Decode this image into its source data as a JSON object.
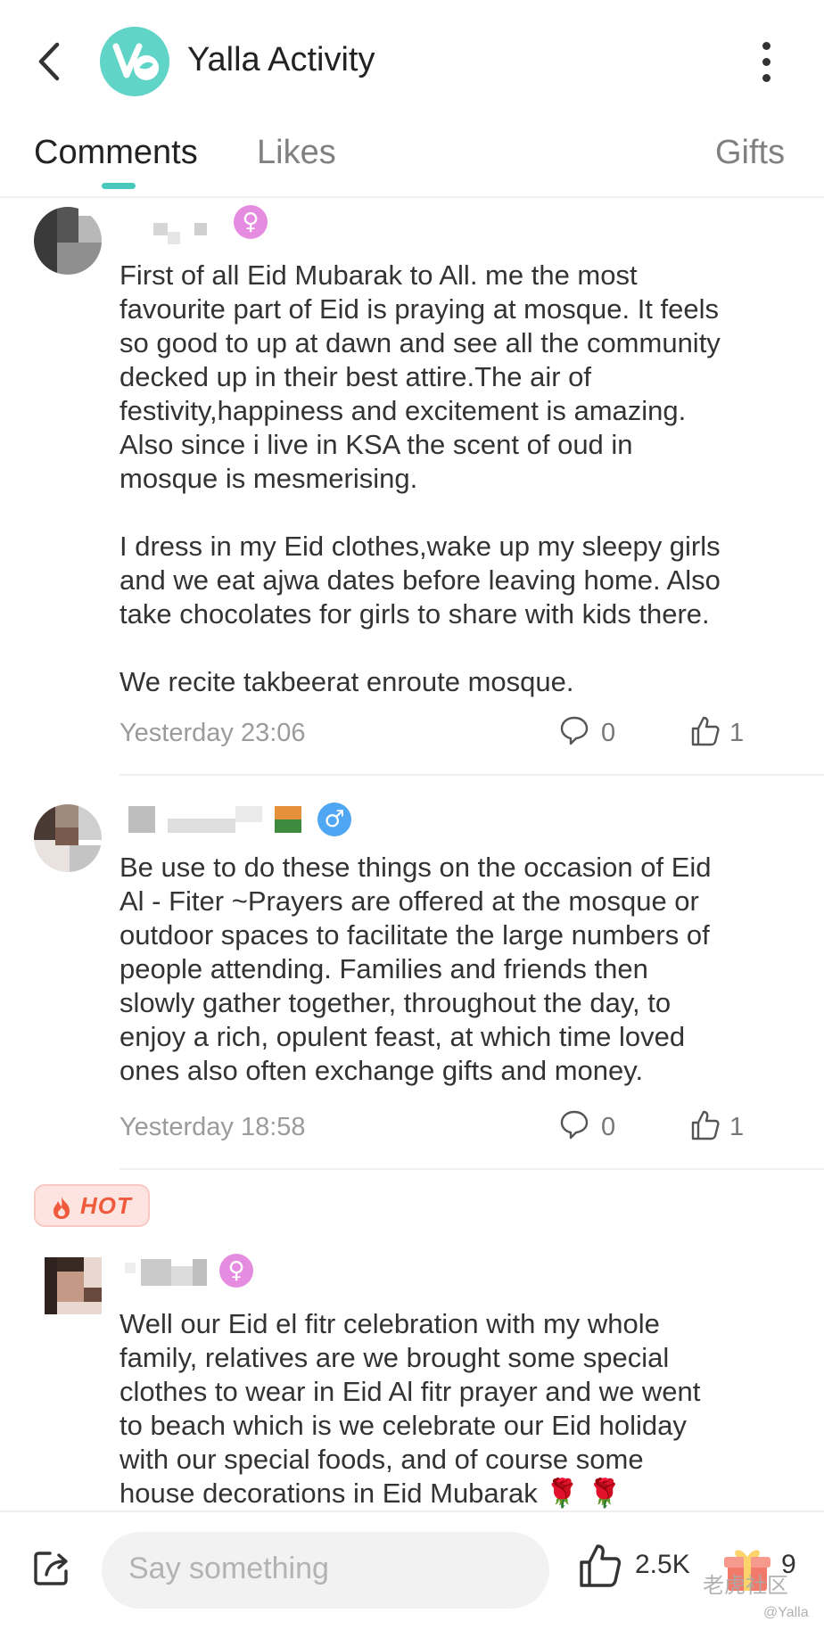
{
  "header": {
    "title": "Yalla Activity",
    "logo_color": "#5fd4c7"
  },
  "tabs": [
    {
      "label": "Comments",
      "active": true
    },
    {
      "label": "Likes",
      "active": false
    },
    {
      "label": "Gifts",
      "active": false
    }
  ],
  "accent_color": "#48c9bc",
  "comments": [
    {
      "gender": "female",
      "gender_icon": "female-symbol-icon",
      "text": "First of all Eid Mubarak to All. me the most\nfavourite part of Eid is praying at mosque. It feels\nso good to up at dawn and see all the community\ndecked up in their best attire.The air of\nfestivity,happiness and excitement is amazing.\nAlso since i live in KSA the scent of oud in\nmosque is mesmerising.\n\nI dress in my Eid clothes,wake up my sleepy girls\nand we eat ajwa dates before leaving home. Also\ntake chocolates for girls to share with kids there.\n\nWe recite takbeerat enroute mosque.",
      "time": "Yesterday 23:06",
      "replies": "0",
      "likes": "1"
    },
    {
      "gender": "male",
      "gender_icon": "male-symbol-icon",
      "text": "Be use to do these things on the occasion of Eid\nAl - Fiter ~Prayers are offered at the mosque or\noutdoor spaces to facilitate the large numbers of\npeople attending. Families and friends then\nslowly gather together, throughout the day, to\nenjoy a rich, opulent feast, at which time loved\nones also often exchange gifts and money.",
      "time": "Yesterday 18:58",
      "replies": "0",
      "likes": "1"
    },
    {
      "gender": "female",
      "gender_icon": "female-symbol-icon",
      "hot_label": "HOT",
      "text": "Well our Eid el fitr celebration with my whole\nfamily, relatives are we brought some special\nclothes to wear in Eid Al fitr prayer and we went\nto beach which is we celebrate our Eid holiday\nwith our special foods, and of course some\nhouse decorations in Eid Mubarak 🌹 🌹"
    }
  ],
  "bottom_bar": {
    "placeholder": "Say something",
    "likes": "2.5K",
    "gifts": "9",
    "watermark": "老虎社区",
    "watermark_sub": "@Yalla"
  }
}
